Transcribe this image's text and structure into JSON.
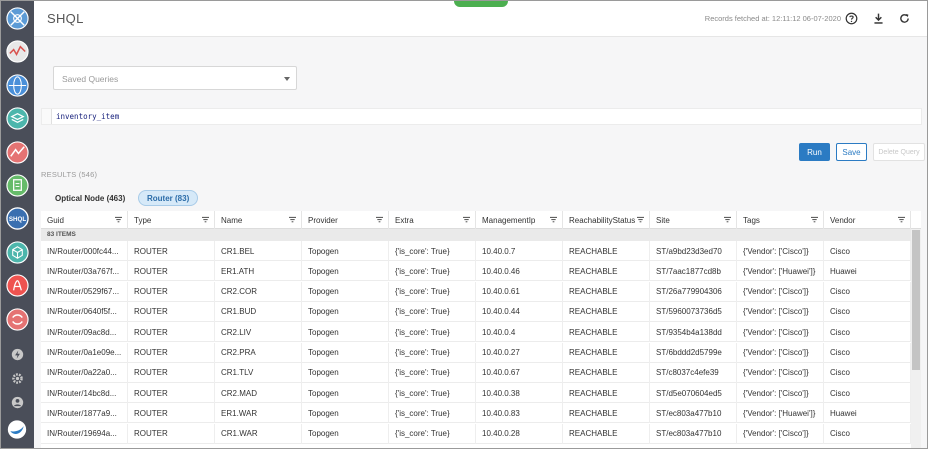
{
  "header": {
    "title": "SHQL",
    "records_fetched": "Records fetched at: 12:11:12 06-07-2020",
    "icons": [
      "help-icon",
      "download-icon",
      "refresh-icon"
    ]
  },
  "sidebar": {
    "icons": [
      "network-map-icon",
      "analytics-icon",
      "globe-icon",
      "layers-icon",
      "alarm-icon",
      "document-icon",
      "shql-icon",
      "package-icon",
      "pdf-icon",
      "sync-icon",
      "lightning-icon",
      "settings-icon",
      "user-icon",
      "brand-logo-icon"
    ],
    "shql_label": "SHQL"
  },
  "query": {
    "saved_placeholder": "Saved Queries",
    "code": "inventory_item"
  },
  "buttons": {
    "run": "Run",
    "save": "Save",
    "delete": "Delete Query"
  },
  "results": {
    "label": "RESULTS (546)",
    "tabs": [
      {
        "label": "Optical Node (463)",
        "active": false
      },
      {
        "label": "Router (83)",
        "active": true
      }
    ],
    "items_count": "83 ITEMS",
    "columns": [
      "Guid",
      "Type",
      "Name",
      "Provider",
      "Extra",
      "ManagementIp",
      "ReachabilityStatus",
      "Site",
      "Tags",
      "Vendor"
    ],
    "rows": [
      [
        "IN/Router/000fc44...",
        "ROUTER",
        "CR1.BEL",
        "Topogen",
        "{'is_core': True}",
        "10.40.0.7",
        "REACHABLE",
        "ST/a9bd23d3ed70",
        "{'Vendor': ['Cisco']}",
        "Cisco"
      ],
      [
        "IN/Router/03a767f...",
        "ROUTER",
        "ER1.ATH",
        "Topogen",
        "{'is_core': True}",
        "10.40.0.46",
        "REACHABLE",
        "ST/7aac1877cd8b",
        "{'Vendor': ['Huawei']}",
        "Huawei"
      ],
      [
        "IN/Router/0529f67...",
        "ROUTER",
        "CR2.COR",
        "Topogen",
        "{'is_core': True}",
        "10.40.0.61",
        "REACHABLE",
        "ST/26a779904306",
        "{'Vendor': ['Cisco']}",
        "Cisco"
      ],
      [
        "IN/Router/0640f5f...",
        "ROUTER",
        "CR1.BUD",
        "Topogen",
        "{'is_core': True}",
        "10.40.0.44",
        "REACHABLE",
        "ST/5960073736d5",
        "{'Vendor': ['Cisco']}",
        "Cisco"
      ],
      [
        "IN/Router/09ac8d...",
        "ROUTER",
        "CR2.LIV",
        "Topogen",
        "{'is_core': True}",
        "10.40.0.4",
        "REACHABLE",
        "ST/9354b4a138dd",
        "{'Vendor': ['Cisco']}",
        "Cisco"
      ],
      [
        "IN/Router/0a1e09e...",
        "ROUTER",
        "CR2.PRA",
        "Topogen",
        "{'is_core': True}",
        "10.40.0.27",
        "REACHABLE",
        "ST/6bddd2d5799e",
        "{'Vendor': ['Cisco']}",
        "Cisco"
      ],
      [
        "IN/Router/0a22a0...",
        "ROUTER",
        "CR1.TLV",
        "Topogen",
        "{'is_core': True}",
        "10.40.0.67",
        "REACHABLE",
        "ST/c8037c4efe39",
        "{'Vendor': ['Cisco']}",
        "Cisco"
      ],
      [
        "IN/Router/14bc8d...",
        "ROUTER",
        "CR2.MAD",
        "Topogen",
        "{'is_core': True}",
        "10.40.0.38",
        "REACHABLE",
        "ST/d5e070604ed5",
        "{'Vendor': ['Cisco']}",
        "Cisco"
      ],
      [
        "IN/Router/1877a9...",
        "ROUTER",
        "ER1.WAR",
        "Topogen",
        "{'is_core': True}",
        "10.40.0.83",
        "REACHABLE",
        "ST/ec803a477b10",
        "{'Vendor': ['Huawei']}",
        "Huawei"
      ],
      [
        "IN/Router/19694a...",
        "ROUTER",
        "CR1.WAR",
        "Topogen",
        "{'is_core': True}",
        "10.40.0.28",
        "REACHABLE",
        "ST/ec803a477b10",
        "{'Vendor': ['Cisco']}",
        "Cisco"
      ]
    ]
  },
  "colors": {
    "sidebar_bg": "#4a4e59",
    "primary": "#2b7bc3",
    "accent_green": "#4caf50"
  }
}
